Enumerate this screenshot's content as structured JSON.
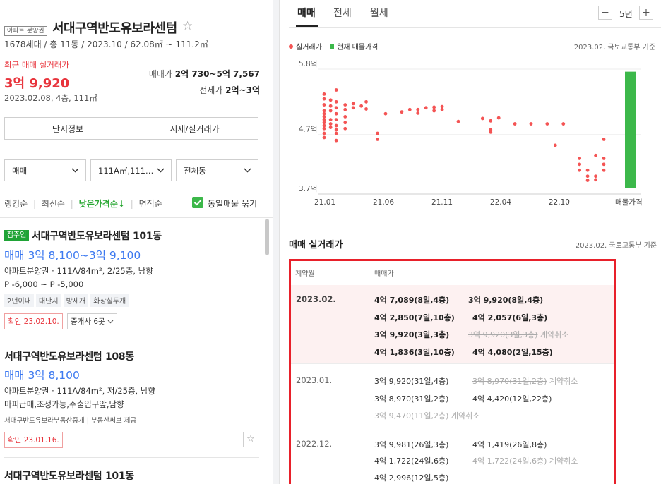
{
  "header": {
    "type_badge": "아파트 분양권",
    "complex_name": "서대구역반도유보라센텀",
    "details": "1678세대 / 총 11동 / 2023.10 / 62.08㎡ ~ 111.2㎡",
    "recent_label": "최근 매매 실거래가",
    "recent_price": "3억 9,920",
    "recent_detail": "2023.02.08, 4층, 111㎡",
    "sale_label": "매매가",
    "sale_range": "2억 730~5억 7,567",
    "jeonse_label": "전세가",
    "jeonse_range": "2억~3억",
    "btn_info": "단지정보",
    "btn_price": "시세/실거래가"
  },
  "filters": {
    "trade_type": "매매",
    "area": "111A㎡,111…",
    "building": "전체동"
  },
  "sort": {
    "ranking": "랭킹순",
    "latest": "최신순",
    "low_price": "낮은가격순↓",
    "area": "면적순",
    "group_label": "동일매물 묶기"
  },
  "listings": [
    {
      "badge": "집주인",
      "title": "서대구역반도유보라센텀 101동",
      "price": "매매 3억 8,100~3억 9,100",
      "spec": "아파트분양권 · 111A/84m², 2/25층, 남향",
      "premium": "P -6,000 ~ P -5,000",
      "tags": [
        "2년이내",
        "대단지",
        "방세개",
        "화장실두개"
      ],
      "confirm": "확인 23.02.10.",
      "agents": "중개사 6곳"
    },
    {
      "title": "서대구역반도유보라센텀 108동",
      "price": "매매 3억 8,100",
      "spec": "아파트분양권 · 111A/84m², 저/25층, 남향",
      "desc": "마피급매,조정가능,주출입구앞,남향",
      "agent": "서대구반도유보라부동산중개",
      "provider": "부동산써브 제공",
      "confirm": "확인 23.01.16."
    },
    {
      "title": "서대구역반도유보라센텀 101동"
    }
  ],
  "tabs": {
    "sale": "매매",
    "jeonse": "전세",
    "monthly": "월세",
    "period": "5년",
    "minus": "−",
    "plus": "+"
  },
  "chart_legend": {
    "actual": "실거래가",
    "current": "현재 매물가격",
    "source": "2023.02. 국토교통부 기준"
  },
  "chart_data": {
    "type": "scatter",
    "y_ticks": [
      "5.8억",
      "4.7억",
      "3.7억"
    ],
    "x_ticks": [
      "21.01",
      "21.06",
      "21.11",
      "22.04",
      "22.10",
      "매물가격"
    ],
    "ylim": [
      3.7,
      5.8
    ],
    "series": [
      {
        "name": "실거래가",
        "color": "#f45454",
        "points": [
          [
            0,
            5.38
          ],
          [
            0,
            5.3
          ],
          [
            0,
            5.2
          ],
          [
            0,
            5.1
          ],
          [
            0,
            5.05
          ],
          [
            0,
            5.0
          ],
          [
            0,
            4.95
          ],
          [
            0,
            4.9
          ],
          [
            0,
            4.85
          ],
          [
            0,
            4.8
          ],
          [
            0,
            4.72
          ],
          [
            0,
            4.65
          ],
          [
            0.8,
            5.28
          ],
          [
            0.8,
            5.18
          ],
          [
            0.8,
            5.1
          ],
          [
            0.8,
            4.95
          ],
          [
            0.8,
            4.88
          ],
          [
            0.8,
            4.82
          ],
          [
            1.5,
            5.45
          ],
          [
            1.5,
            5.25
          ],
          [
            1.5,
            5.15
          ],
          [
            1.5,
            5.05
          ],
          [
            1.5,
            4.95
          ],
          [
            1.5,
            4.85
          ],
          [
            1.5,
            4.78
          ],
          [
            1.5,
            4.72
          ],
          [
            1.5,
            4.6
          ],
          [
            2.6,
            5.2
          ],
          [
            2.6,
            5.12
          ],
          [
            2.6,
            5.0
          ],
          [
            2.6,
            4.9
          ],
          [
            2.6,
            4.8
          ],
          [
            3.6,
            5.15
          ],
          [
            3.6,
            5.22
          ],
          [
            4.6,
            5.18
          ],
          [
            5.2,
            5.25
          ],
          [
            5.2,
            5.13
          ],
          [
            6.6,
            4.72
          ],
          [
            6.6,
            4.62
          ],
          [
            7.6,
            5.05
          ],
          [
            9.6,
            5.08
          ],
          [
            10.6,
            5.12
          ],
          [
            11.6,
            5.12
          ],
          [
            11.6,
            5.06
          ],
          [
            12.6,
            5.15
          ],
          [
            13.6,
            5.16
          ],
          [
            13.6,
            5.1
          ],
          [
            14.6,
            5.17
          ],
          [
            14.6,
            5.12
          ],
          [
            16.6,
            4.92
          ],
          [
            19.6,
            4.97
          ],
          [
            20.6,
            4.93
          ],
          [
            20.6,
            4.78
          ],
          [
            20.6,
            4.74
          ],
          [
            21.6,
            4.98
          ],
          [
            23.6,
            4.88
          ],
          [
            25.6,
            4.88
          ],
          [
            27.6,
            4.88
          ],
          [
            28.6,
            4.52
          ],
          [
            29.6,
            4.88
          ],
          [
            31.6,
            4.3
          ],
          [
            31.6,
            4.2
          ],
          [
            31.6,
            4.1
          ],
          [
            32.6,
            4.1
          ],
          [
            32.6,
            4.0
          ],
          [
            32.6,
            3.93
          ],
          [
            33.6,
            4.0
          ],
          [
            33.6,
            3.94
          ],
          [
            33.6,
            4.35
          ],
          [
            34.6,
            4.62
          ],
          [
            34.6,
            4.3
          ],
          [
            34.6,
            4.2
          ],
          [
            34.6,
            4.1
          ]
        ]
      },
      {
        "name": "현재 매물가격",
        "color": "#3cb84a",
        "range": [
          3.8,
          5.757
        ]
      }
    ]
  },
  "table": {
    "title": "매매 실거래가",
    "source": "2023.02. 국토교통부 기준",
    "col_month": "계약월",
    "col_price": "매매가",
    "rows": [
      {
        "month": "2023.02.",
        "entries": [
          [
            "4억 7,089(8일,4층)",
            "3억 9,920(8일,4층)"
          ],
          [
            "4억 2,850(7일,10층)",
            "4억 2,057(6일,3층)"
          ],
          [
            "3억 9,920(3일,3층)",
            "3억 9,920(3일,3층)"
          ],
          [
            "4억 1,836(3일,10층)",
            "4억 4,080(2일,15층)"
          ]
        ],
        "cancel_label": "계약취소"
      },
      {
        "month": "2023.01.",
        "entries": [
          [
            "3억 9,920(31일,4층)",
            "3억 8,970(31일,2층)"
          ],
          [
            "3억 8,970(31일,2층)",
            "4억 4,420(12일,22층)"
          ],
          [
            "3억 9,470(11일,2층)",
            ""
          ]
        ],
        "cancel_label": "계약취소"
      },
      {
        "month": "2022.12.",
        "entries": [
          [
            "3억 9,981(26일,3층)",
            "4억 1,419(26일,8층)"
          ],
          [
            "4억 1,722(24일,6층)",
            "4억 1,722(24일,6층)"
          ],
          [
            "4억 2,996(12일,5층)",
            ""
          ]
        ],
        "cancel_label": "계약취소"
      }
    ]
  },
  "colors": {
    "accent_red": "#e8343c",
    "price_blue": "#3c79f0",
    "green": "#3cb84a",
    "chart_red": "#f45454"
  }
}
